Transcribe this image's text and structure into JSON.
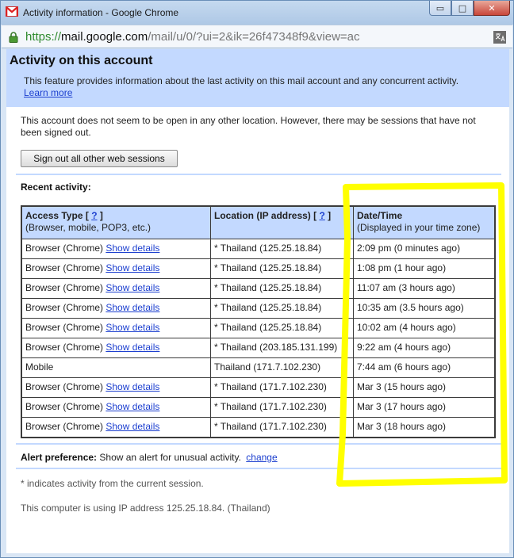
{
  "window": {
    "title": "Activity information - Google Chrome",
    "controls": {
      "minimize": "▭",
      "maximize": "□",
      "close": "✕"
    }
  },
  "address": {
    "scheme": "https://",
    "host": "mail.google.com",
    "path": "/mail/u/0/?ui=2&ik=26f47348f9&view=ac"
  },
  "header": {
    "title": "Activity on this account",
    "description": "This feature provides information about the last activity on this mail account and any concurrent activity.",
    "learn_more": "Learn more"
  },
  "notice": "This account does not seem to be open in any other location. However, there may be sessions that have not been signed out.",
  "signout_button": "Sign out all other web sessions",
  "recent_label": "Recent activity:",
  "table": {
    "headers": {
      "access": {
        "title": "Access Type",
        "help": "?",
        "sub": "(Browser, mobile, POP3, etc.)"
      },
      "location": {
        "title": "Location (IP address)",
        "help": "?"
      },
      "datetime": {
        "title": "Date/Time",
        "sub": "(Displayed in your time zone)"
      }
    },
    "rows": [
      {
        "access": "Browser (Chrome)",
        "details": "Show details",
        "location": "* Thailand (125.25.18.84)",
        "time": "2:09 pm (0 minutes ago)"
      },
      {
        "access": "Browser (Chrome)",
        "details": "Show details",
        "location": "* Thailand (125.25.18.84)",
        "time": "1:08 pm (1 hour ago)"
      },
      {
        "access": "Browser (Chrome)",
        "details": "Show details",
        "location": "* Thailand (125.25.18.84)",
        "time": "11:07 am (3 hours ago)"
      },
      {
        "access": "Browser (Chrome)",
        "details": "Show details",
        "location": "* Thailand (125.25.18.84)",
        "time": "10:35 am (3.5 hours ago)"
      },
      {
        "access": "Browser (Chrome)",
        "details": "Show details",
        "location": "* Thailand (125.25.18.84)",
        "time": "10:02 am (4 hours ago)"
      },
      {
        "access": "Browser (Chrome)",
        "details": "Show details",
        "location": "* Thailand (203.185.131.199)",
        "time": "9:22 am (4 hours ago)"
      },
      {
        "access": "Mobile",
        "details": "",
        "location": "Thailand (171.7.102.230)",
        "time": "7:44 am (6 hours ago)"
      },
      {
        "access": "Browser (Chrome)",
        "details": "Show details",
        "location": "* Thailand (171.7.102.230)",
        "time": "Mar 3 (15 hours ago)"
      },
      {
        "access": "Browser (Chrome)",
        "details": "Show details",
        "location": "* Thailand (171.7.102.230)",
        "time": "Mar 3 (17 hours ago)"
      },
      {
        "access": "Browser (Chrome)",
        "details": "Show details",
        "location": "* Thailand (171.7.102.230)",
        "time": "Mar 3 (18 hours ago)"
      }
    ]
  },
  "alert": {
    "label": "Alert preference:",
    "text": "Show an alert for unusual activity.",
    "link": "change"
  },
  "footnote": "* indicates activity from the current session.",
  "ip_note": "This computer is using IP address 125.25.18.84. (Thailand)",
  "colors": {
    "header_bg": "#c3d9ff",
    "link": "#1c3fcf",
    "highlight": "#ffff00",
    "secure_green": "#2f8a2f"
  }
}
